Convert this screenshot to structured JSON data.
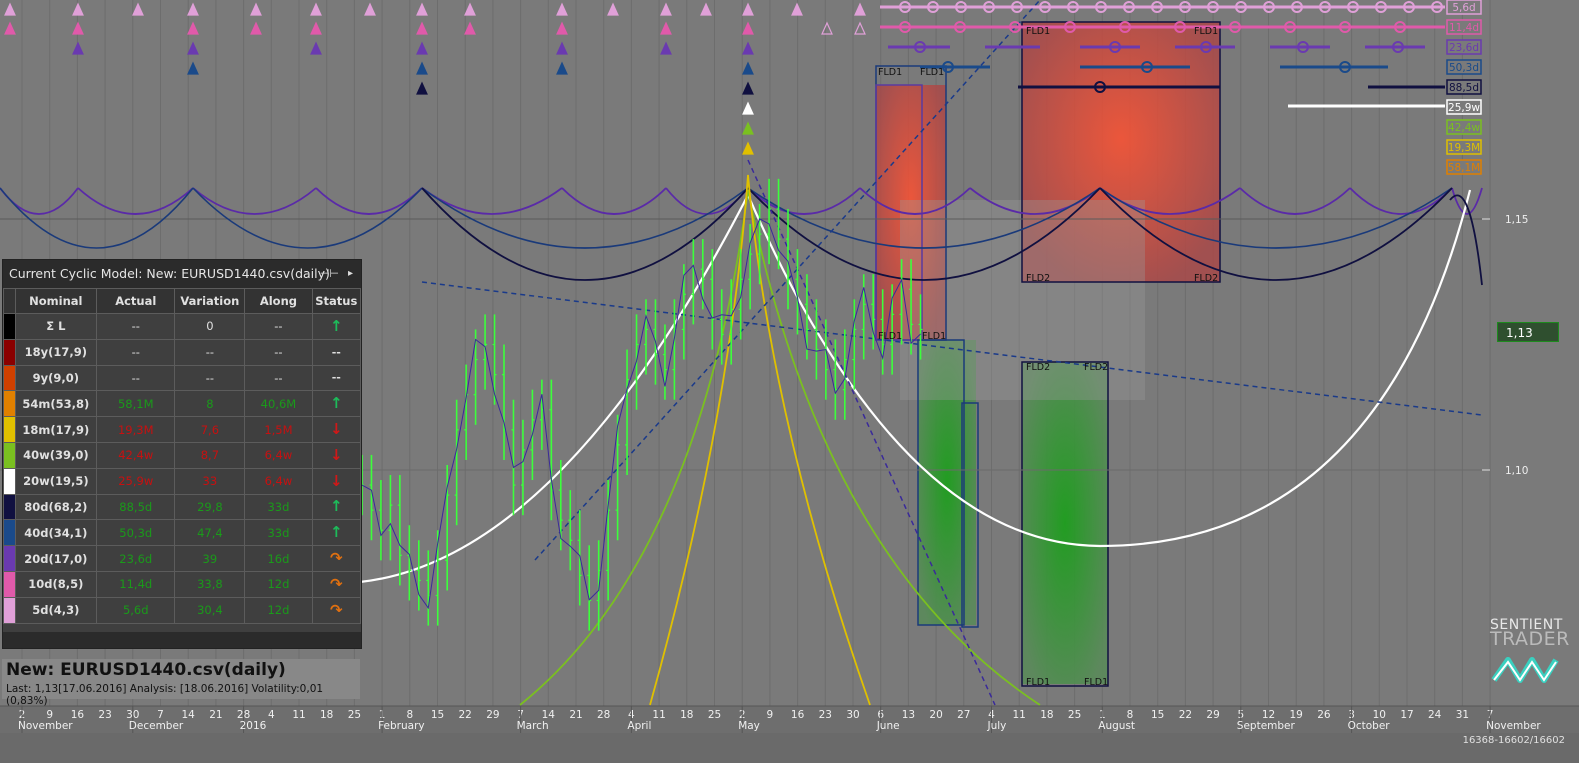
{
  "chart_data": {
    "type": "bar",
    "title": "New: EURUSD1440.csv(daily)",
    "info_line": "Last: 1,13[17.06.2016] Analysis: [18.06.2016] Volatility:0,01 (0,83%)",
    "y_ticks": [
      {
        "label": "1,15",
        "value": 1.15
      },
      {
        "label": "1,10",
        "value": 1.1
      }
    ],
    "last_price_label": "1,13",
    "x_ticks": [
      "2",
      "9",
      "16",
      "23",
      "30",
      "7",
      "14",
      "21",
      "28",
      "4",
      "11",
      "18",
      "25",
      "1",
      "8",
      "15",
      "22",
      "29",
      "7",
      "14",
      "21",
      "28",
      "4",
      "11",
      "18",
      "25",
      "2",
      "9",
      "16",
      "23",
      "30",
      "6",
      "13",
      "20",
      "27",
      "4",
      "11",
      "18",
      "25",
      "1",
      "8",
      "15",
      "22",
      "29",
      "5",
      "12",
      "19",
      "26",
      "3",
      "10",
      "17",
      "24",
      "31",
      "7"
    ],
    "month_labels": [
      "November",
      "December",
      "2016",
      "February",
      "March",
      "April",
      "May",
      "June",
      "July",
      "August",
      "September",
      "October",
      "November"
    ],
    "cycle_badges": [
      {
        "label": "5,6d",
        "color": "#e0a0d8"
      },
      {
        "label": "11,4d",
        "color": "#e05aaa"
      },
      {
        "label": "23,6d",
        "color": "#6a3ab0"
      },
      {
        "label": "50,3d",
        "color": "#1a4a8a"
      },
      {
        "label": "88,5d",
        "color": "#101040"
      },
      {
        "label": "25,9w",
        "color": "#ffffff"
      },
      {
        "label": "42,4w",
        "color": "#7ac020"
      },
      {
        "label": "19,3M",
        "color": "#e0c000"
      },
      {
        "label": "58,1M",
        "color": "#e08000"
      }
    ],
    "fld_labels": [
      "FLD1",
      "FLD1",
      "FLD1",
      "FLD1",
      "FLD2",
      "FLD2",
      "FLD2",
      "FLD2",
      "FLD1",
      "FLD1",
      "FLD1",
      "FLD1"
    ],
    "price_series_approx": [
      1.097,
      1.092,
      1.088,
      1.093,
      1.083,
      1.08,
      1.078,
      1.075,
      1.082,
      1.095,
      1.108,
      1.115,
      1.122,
      1.125,
      1.119,
      1.108,
      1.097,
      1.104,
      1.11,
      1.112,
      1.096,
      1.09,
      1.086,
      1.079,
      1.074,
      1.08,
      1.092,
      1.105,
      1.118,
      1.125,
      1.128,
      1.123,
      1.12,
      1.128,
      1.135,
      1.14,
      1.138,
      1.13,
      1.127,
      1.132,
      1.138,
      1.143,
      1.147,
      1.152,
      1.146,
      1.138,
      1.133,
      1.128,
      1.124,
      1.12,
      1.116,
      1.122,
      1.128,
      1.133,
      1.13,
      1.125,
      1.131,
      1.136,
      1.129,
      1.128
    ]
  },
  "panel": {
    "title": "Current Cyclic Model: New: EURUSD1440.csv(daily)",
    "pin": "⊣⊢",
    "arrow": "▸",
    "headers": [
      "Nominal",
      "Actual",
      "Variation",
      "Along",
      "Status"
    ],
    "rows": [
      {
        "color": "#000000",
        "nominal": "Σ L",
        "actual": "--",
        "variation": "0",
        "along": "--",
        "status": "up",
        "vc": "#e0e0e0"
      },
      {
        "color": "#8a0000",
        "nominal": "18y(17,9)",
        "actual": "--",
        "variation": "--",
        "along": "--",
        "status": "none",
        "vc": "#e0e0e0"
      },
      {
        "color": "#d04000",
        "nominal": "9y(9,0)",
        "actual": "--",
        "variation": "--",
        "along": "--",
        "status": "none",
        "vc": "#e0e0e0"
      },
      {
        "color": "#e08000",
        "nominal": "54m(53,8)",
        "actual": "58,1M",
        "variation": "8",
        "along": "40,6M",
        "status": "up",
        "vc": "#1a9a1a"
      },
      {
        "color": "#e0c000",
        "nominal": "18m(17,9)",
        "actual": "19,3M",
        "variation": "7,6",
        "along": "1,5M",
        "status": "down",
        "vc": "#c81010"
      },
      {
        "color": "#7ac020",
        "nominal": "40w(39,0)",
        "actual": "42,4w",
        "variation": "8,7",
        "along": "6,4w",
        "status": "down",
        "vc": "#c81010"
      },
      {
        "color": "#ffffff",
        "nominal": "20w(19,5)",
        "actual": "25,9w",
        "variation": "33",
        "along": "6,4w",
        "status": "down",
        "vc": "#c81010"
      },
      {
        "color": "#101040",
        "nominal": "80d(68,2)",
        "actual": "88,5d",
        "variation": "29,8",
        "along": "33d",
        "status": "up",
        "vc": "#1a9a1a"
      },
      {
        "color": "#1a4a8a",
        "nominal": "40d(34,1)",
        "actual": "50,3d",
        "variation": "47,4",
        "along": "33d",
        "status": "up",
        "vc": "#1a9a1a"
      },
      {
        "color": "#6a3ab0",
        "nominal": "20d(17,0)",
        "actual": "23,6d",
        "variation": "39",
        "along": "16d",
        "status": "turn",
        "vc": "#1a9a1a"
      },
      {
        "color": "#e05aaa",
        "nominal": "10d(8,5)",
        "actual": "11,4d",
        "variation": "33,8",
        "along": "12d",
        "status": "turn",
        "vc": "#1a9a1a"
      },
      {
        "color": "#e0a0d8",
        "nominal": "5d(4,3)",
        "actual": "5,6d",
        "variation": "30,4",
        "along": "12d",
        "status": "turn",
        "vc": "#1a9a1a"
      }
    ]
  },
  "brand": {
    "line1": "SENTIENT",
    "line2": "TRADER"
  },
  "counter": "16368-16602/16602",
  "colors": {
    "up": "#1dbb5a",
    "down": "#d01818",
    "turn": "#e07010",
    "bars": "#3cff3c"
  }
}
